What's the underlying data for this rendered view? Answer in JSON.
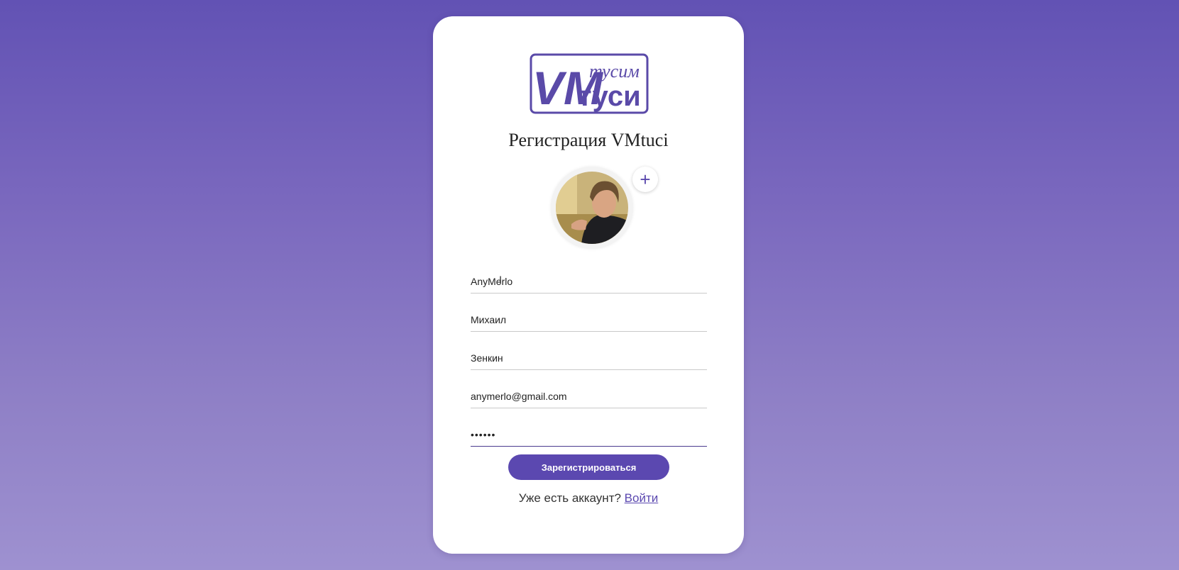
{
  "logo": {
    "top_text": "тусим",
    "main_text": "VM",
    "sub_text": "туси"
  },
  "title": "Регистрация VMtuci",
  "avatar": {
    "add_label": "+"
  },
  "form": {
    "username": "AnyMerlo",
    "first_name": "Михаил",
    "last_name": "Зенкин",
    "email": "anymerlo@gmail.com",
    "password": "••••••"
  },
  "submit_label": "Зарегистрироваться",
  "login_prompt": "Уже есть аккаунт?",
  "login_link": "Войти",
  "colors": {
    "accent": "#5b48b0",
    "logo": "#5a4aa8",
    "background_top": "#6252b4",
    "background_bottom": "#9e91d0"
  }
}
